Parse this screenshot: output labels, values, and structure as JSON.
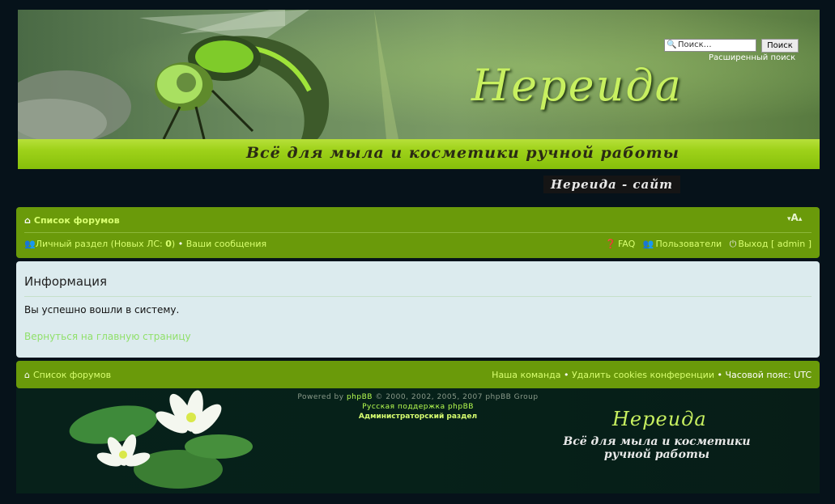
{
  "header": {
    "title": "Нереида",
    "slogan": "Всё для мыла и косметики ручной работы",
    "search_placeholder": "Поиск…",
    "search_button": "Поиск",
    "advanced_search": "Расширенный поиск",
    "site_link": "Нереида - сайт"
  },
  "navbar": {
    "forum_index": "Список форумов",
    "font_size_control": "A",
    "ucp": "Личный раздел",
    "new_pm_prefix": "(Новых ЛС:",
    "new_pm_count": "0",
    "new_pm_suffix": ")",
    "bullet": "•",
    "your_posts": "Ваши сообщения",
    "faq": "FAQ",
    "members": "Пользователи",
    "logout": "Выход",
    "logout_user": "[ admin ]"
  },
  "panel": {
    "heading": "Информация",
    "message": "Вы успешно вошли в систему.",
    "back_link": "Вернуться на главную страницу"
  },
  "footer_nav": {
    "forum_index": "Список форумов",
    "team": "Наша команда",
    "bullet": "•",
    "delete_cookies": "Удалить cookies конференции",
    "timezone_label": "Часовой пояс:",
    "timezone_value": "UTC"
  },
  "copyright": {
    "powered_prefix": "Powered by",
    "powered_brand": "phpBB",
    "powered_suffix": "© 2000, 2002, 2005, 2007 phpBB Group",
    "russian_support": "Русская поддержка phpBB",
    "admin_panel": "Администраторский раздел",
    "brand_title": "Нереида",
    "brand_slogan_line1": "Всё для мыла и косметики",
    "brand_slogan_line2": "ручной работы"
  },
  "icons": {
    "home": "home-icon",
    "ucp": "members-icon",
    "faq": "faq-icon",
    "members": "members-icon",
    "logout": "logout-icon",
    "search": "search-icon"
  },
  "colors": {
    "nav_green": "#6a9a0a",
    "link_lime": "#d8ff70",
    "panel_bg": "#dcebee",
    "page_bg": "#06121a"
  }
}
